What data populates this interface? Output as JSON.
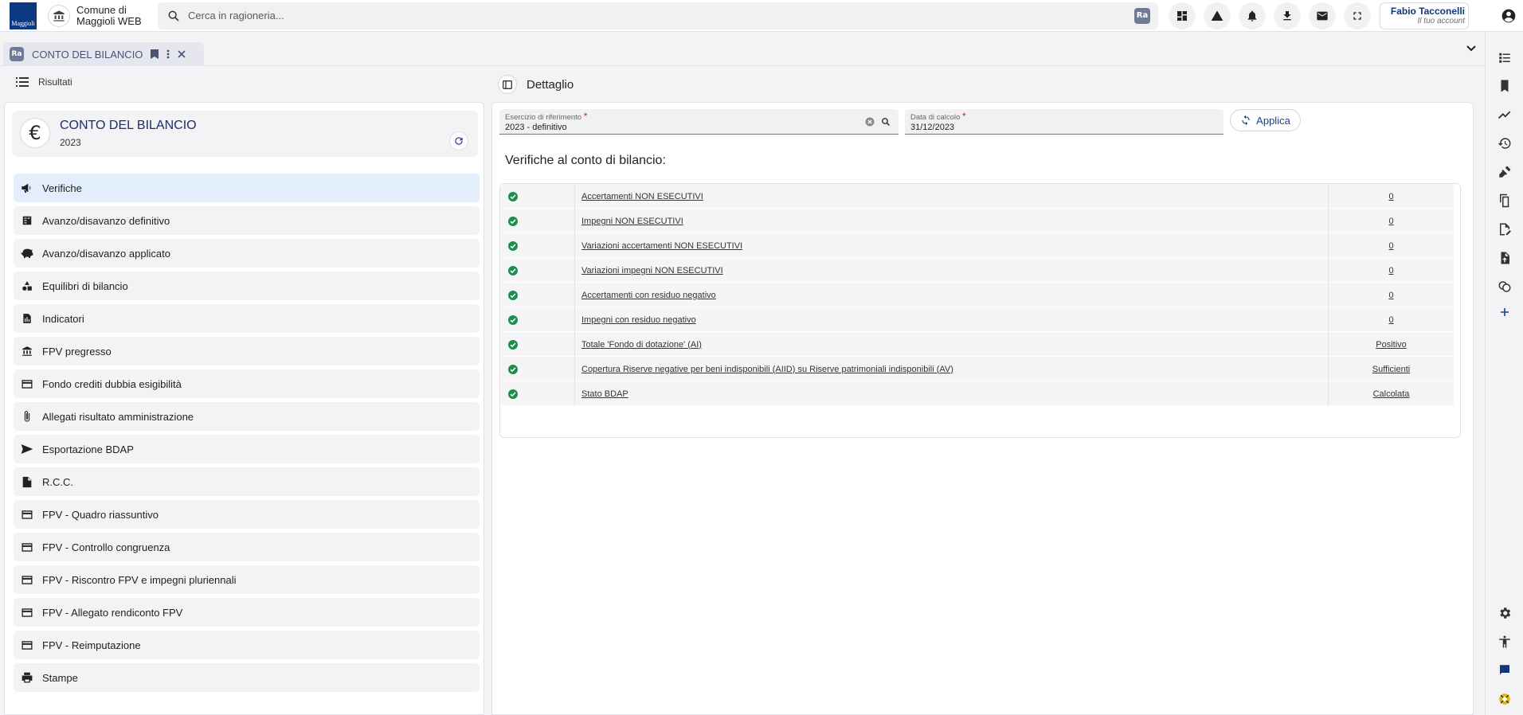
{
  "header": {
    "logo_text": "Maggioli",
    "institution_name": "Comune di Maggioli WEB",
    "search_placeholder": "Cerca in ragioneria...",
    "app_badge": "Ra",
    "user_name": "Fabio Tacconelli",
    "user_subtitle": "Il tuo account"
  },
  "tab": {
    "badge": "Ra",
    "label": "CONTO DEL BILANCIO"
  },
  "left": {
    "header_label": "Risultati",
    "card_title": "CONTO DEL BILANCIO",
    "card_year": "2023",
    "card_icon_glyph": "€",
    "menu": [
      {
        "label": "Verifiche",
        "icon": "megaphone-icon",
        "active": true
      },
      {
        "label": "Avanzo/disavanzo definitivo",
        "icon": "calculator-icon"
      },
      {
        "label": "Avanzo/disavanzo applicato",
        "icon": "piggy-bank-icon"
      },
      {
        "label": "Equilibri di bilancio",
        "icon": "shapes-icon"
      },
      {
        "label": "Indicatori",
        "icon": "chart-doc-icon"
      },
      {
        "label": "FPV pregresso",
        "icon": "bank-icon"
      },
      {
        "label": "Fondo crediti dubbia esigibilità",
        "icon": "card-icon"
      },
      {
        "label": "Allegati risultato amministrazione",
        "icon": "paperclip-icon"
      },
      {
        "label": "Esportazione BDAP",
        "icon": "send-icon"
      },
      {
        "label": "R.C.C.",
        "icon": "file-icon"
      },
      {
        "label": "FPV - Quadro riassuntivo",
        "icon": "card-icon"
      },
      {
        "label": "FPV - Controllo congruenza",
        "icon": "card-icon"
      },
      {
        "label": "FPV - Riscontro FPV e impegni pluriennali",
        "icon": "card-icon"
      },
      {
        "label": "FPV - Allegato rendiconto FPV",
        "icon": "card-icon"
      },
      {
        "label": "FPV - Reimputazione",
        "icon": "card-icon"
      },
      {
        "label": "Stampe",
        "icon": "printer-icon"
      }
    ]
  },
  "detail": {
    "title": "Dettaglio",
    "esercizio_label": "Esercizio di riferimento",
    "esercizio_value": "2023 - definitivo",
    "data_label": "Data di calcolo",
    "data_value": "31/12/2023",
    "required_mark": "*",
    "apply_label": "Applica",
    "verifiche_title": "Verifiche al conto di bilancio:",
    "rows": [
      {
        "label": "Accertamenti NON ESECUTIVI",
        "value": "0"
      },
      {
        "label": "Impegni NON ESECUTIVI",
        "value": "0"
      },
      {
        "label": "Variazioni accertamenti NON ESECUTIVI",
        "value": "0"
      },
      {
        "label": "Variazioni impegni NON ESECUTIVI",
        "value": "0"
      },
      {
        "label": "Accertamenti con residuo negativo",
        "value": "0"
      },
      {
        "label": "Impegni con residuo negativo",
        "value": "0"
      },
      {
        "label": "Totale 'Fondo di dotazione' (AI)",
        "value": "Positivo"
      },
      {
        "label": "Copertura Riserve negative per beni indisponibili (AIID) su Riserve patrimoniali indisponibili (AV)",
        "value": "Sufficienti"
      },
      {
        "label": "Stato BDAP",
        "value": "Calcolata"
      }
    ]
  },
  "colors": {
    "brand": "#0b3a82",
    "accent": "#1b3f8a",
    "ok": "#1e8e4e",
    "active_bg": "#e3eefc"
  }
}
